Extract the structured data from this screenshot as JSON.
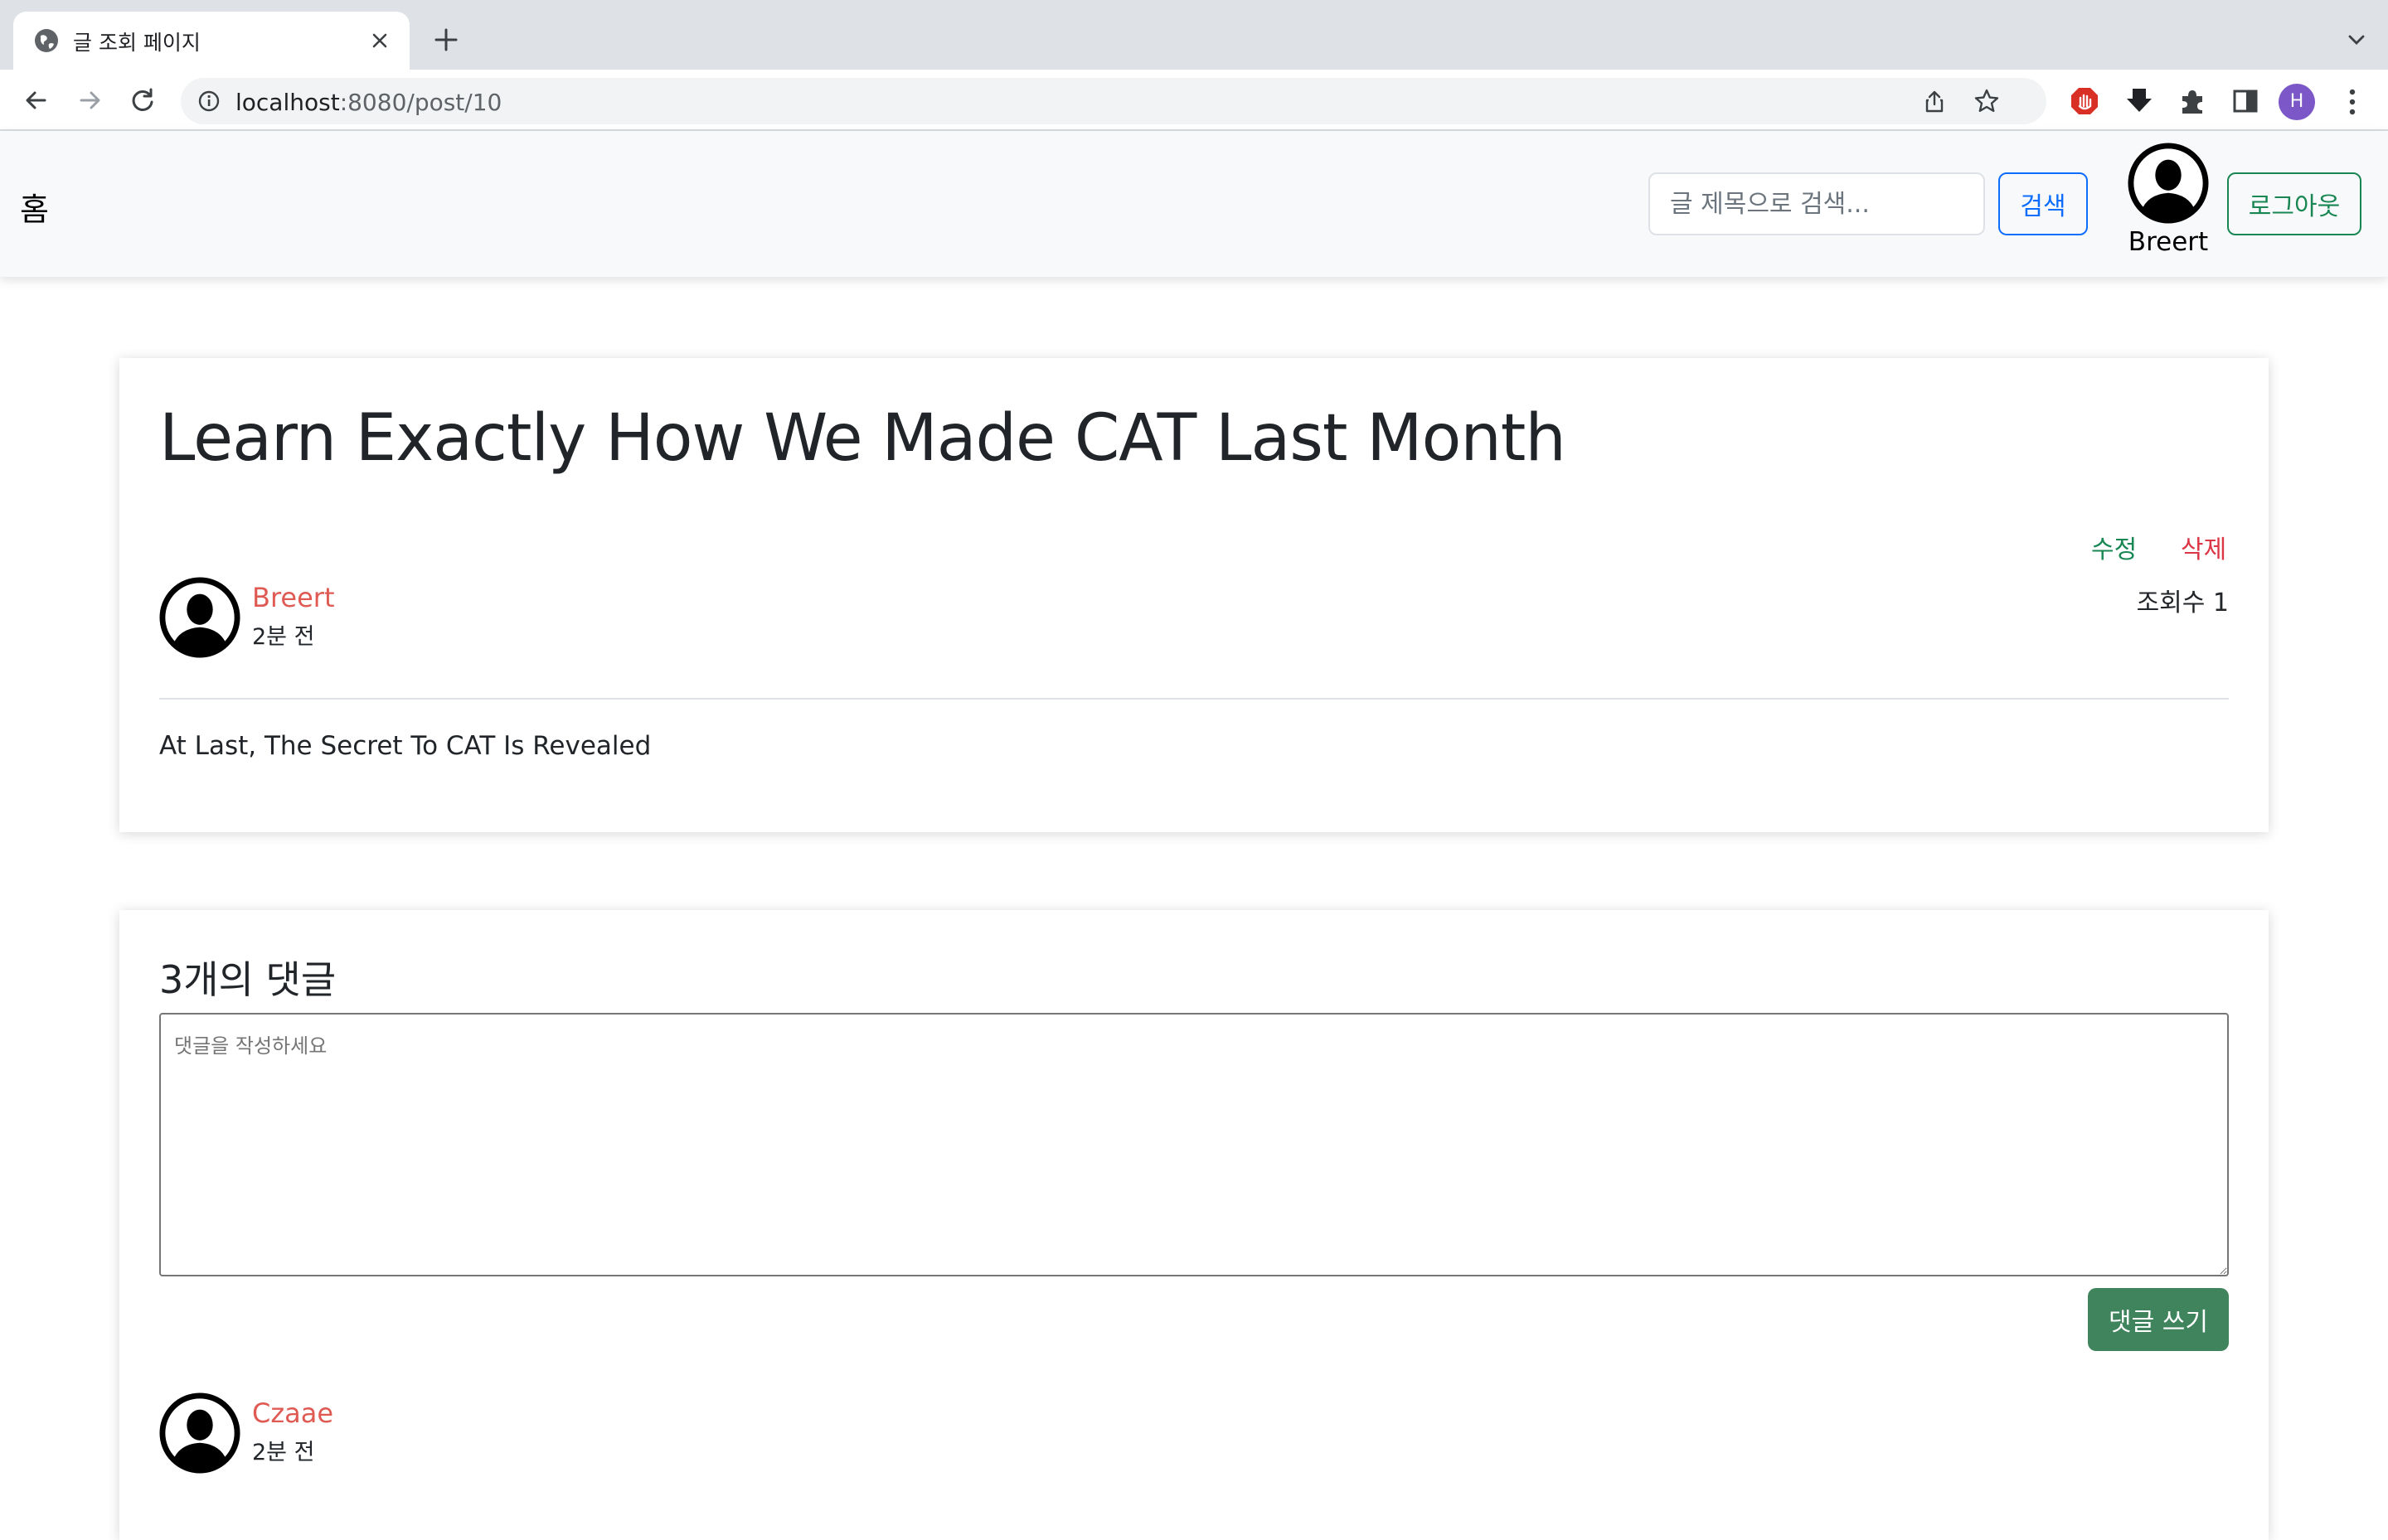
{
  "browser": {
    "tab_title": "글 조회 페이지",
    "url_host": "localhost",
    "url_rest": ":8080/post/10",
    "profile_initial": "H"
  },
  "navbar": {
    "brand": "홈",
    "search_placeholder": "글 제목으로 검색...",
    "search_button": "검색",
    "username": "Breert",
    "logout_button": "로그아웃"
  },
  "post": {
    "title": "Learn Exactly How We Made CAT Last Month",
    "edit_label": "수정",
    "delete_label": "삭제",
    "author": "Breert",
    "time": "2분 전",
    "view_count": "조회수 1",
    "body": "At Last, The Secret To CAT Is Revealed"
  },
  "comments": {
    "heading": "3개의 댓글",
    "placeholder": "댓글을 작성하세요",
    "submit_label": "댓글 쓰기",
    "items": [
      {
        "author": "Czaae",
        "time": "2분 전"
      }
    ]
  },
  "colors": {
    "accent_blue": "#0d6efd",
    "accent_green": "#198754",
    "author_red": "#e05a54",
    "danger_red": "#dc3545"
  }
}
